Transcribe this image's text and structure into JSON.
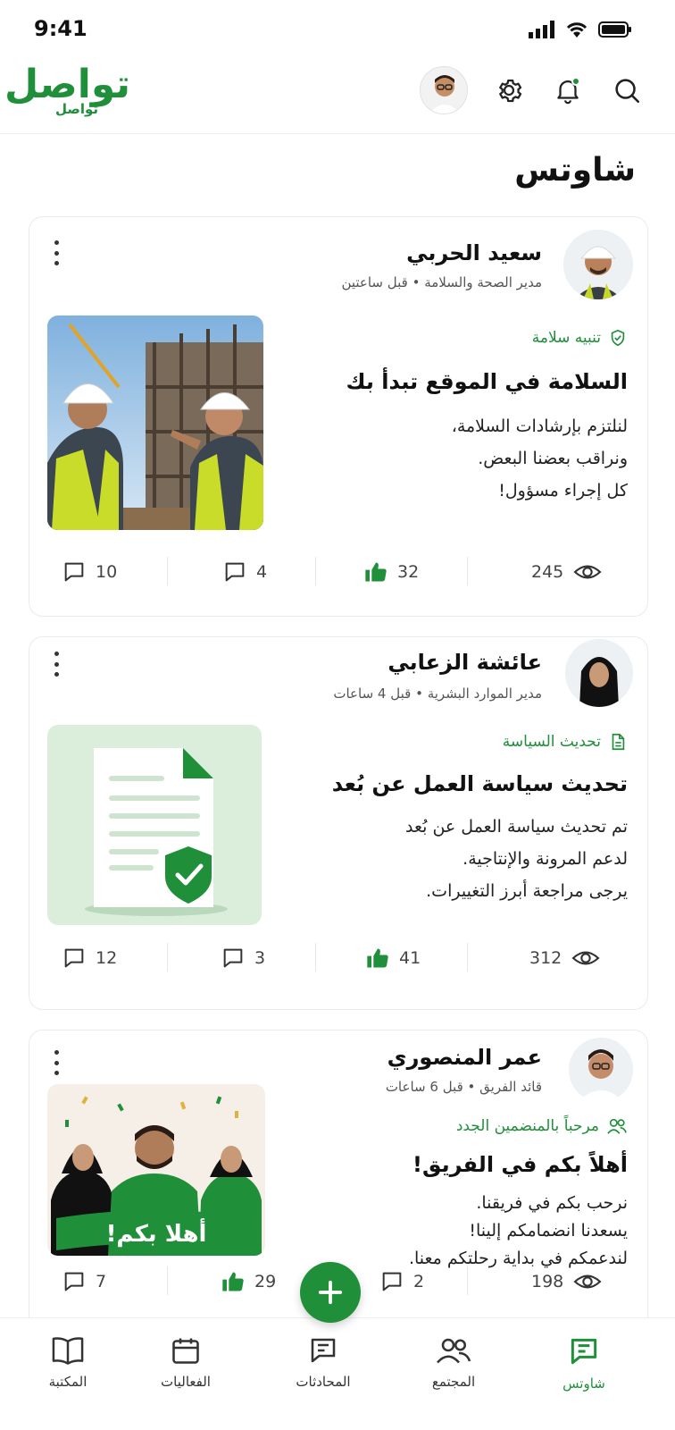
{
  "status_bar": {
    "time": "9:41"
  },
  "header": {
    "logo_main": "تواصل",
    "logo_sub": "تواصل",
    "icons": [
      "search-icon",
      "bell-icon",
      "gear-icon",
      "avatar"
    ]
  },
  "page_title": "شاوتس",
  "posts": [
    {
      "author": "سعيد الحربي",
      "role": "مدير الصحة والسلامة",
      "time": "قبل ساعتين",
      "tag": "تنبيه سلامة",
      "title": "السلامة في الموقع تبدأ بك",
      "body": [
        "لنلتزم بإرشادات السلامة،",
        "ونراقب بعضنا البعض.",
        "كل إجراء مسؤول!"
      ],
      "comments": "10",
      "replies": "4",
      "likes": "32",
      "views": "245"
    },
    {
      "author": "عائشة الزعابي",
      "role": "مدير الموارد البشرية",
      "time": "قبل 4 ساعات",
      "tag": "تحديث السياسة",
      "title": "تحديث سياسة العمل عن بُعد",
      "body": [
        "تم تحديث سياسة العمل عن بُعد",
        "لدعم المرونة والإنتاجية.",
        "يرجى مراجعة أبرز التغييرات."
      ],
      "comments": "12",
      "replies": "3",
      "likes": "41",
      "views": "312"
    },
    {
      "author": "عمر المنصوري",
      "role": "قائد الفريق",
      "time": "قبل 6 ساعات",
      "tag": "مرحباً بالمنضمين الجدد",
      "title": "أهلاً بكم في الفريق!",
      "body": [
        "نرحب بكم في فريقنا.",
        "يسعدنا انضمامكم إلينا!",
        "لندعمكم في بداية رحلتكم معنا."
      ],
      "banner": "أهلا بكم!",
      "comments": "7",
      "likes": "29",
      "replies": "2",
      "views": "198"
    }
  ],
  "bottom_nav": [
    {
      "label": "المكتبة",
      "icon": "book-icon"
    },
    {
      "label": "الفعاليات",
      "icon": "calendar-icon"
    },
    {
      "label": "المحادثات",
      "icon": "chat-icon"
    },
    {
      "label": "المجتمع",
      "icon": "people-icon"
    },
    {
      "label": "شاوتس",
      "icon": "shorts-icon",
      "active": true
    }
  ],
  "colors": {
    "accent": "#1f8f3a",
    "text": "#111111",
    "muted": "#555555"
  }
}
